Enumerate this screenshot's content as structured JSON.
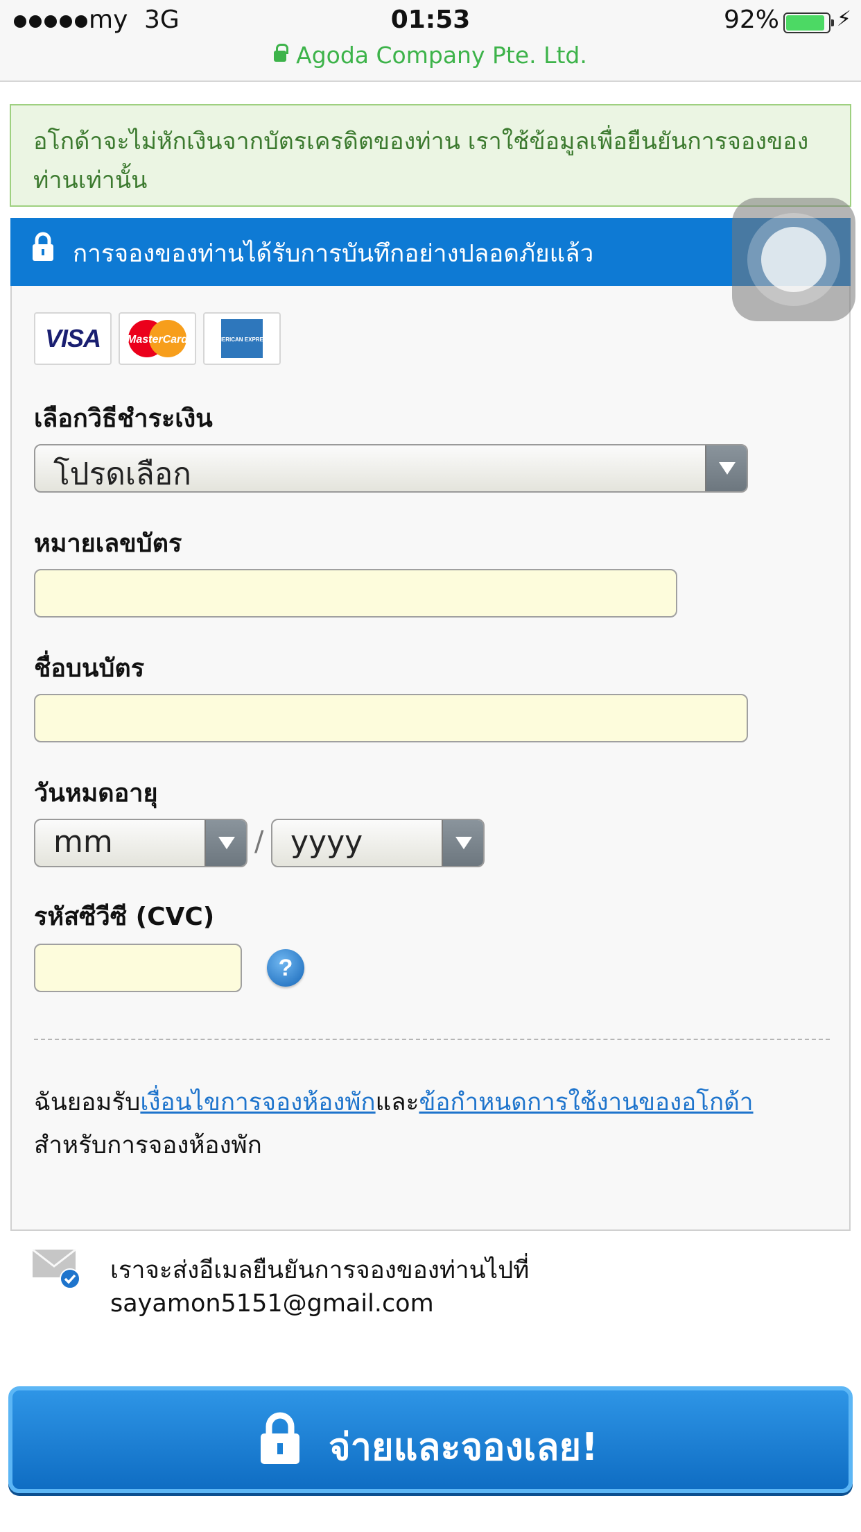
{
  "status_bar": {
    "carrier": "my",
    "network": "3G",
    "time": "01:53",
    "battery_percent": "92%",
    "battery_level": 0.92,
    "url": "Agoda Company Pte. Ltd."
  },
  "notice": {
    "text": "อโกด้าจะไม่หักเงินจากบัตรเครดิตของท่าน เราใช้ข้อมูลเพื่อยืนยันการจองของท่านเท่านั้น"
  },
  "secure_banner": {
    "text": "การจองของท่านได้รับการบันทึกอย่างปลอดภัยแล้ว"
  },
  "card_logos": [
    "visa-icon",
    "mastercard-icon",
    "amex-icon"
  ],
  "card_logo_text": {
    "visa": "VISA",
    "mastercard": "MasterCard",
    "amex": "AMERICAN EXPRESS"
  },
  "form": {
    "payment_method_label": "เลือกวิธีชำระเงิน",
    "payment_method_value": "โปรดเลือก",
    "card_number_label": "หมายเลขบัตร",
    "card_number_value": "",
    "card_name_label": "ชื่อบนบัตร",
    "card_name_value": "",
    "expiry_label": "วันหมดอายุ",
    "expiry_month_value": "mm",
    "expiry_separator": "/",
    "expiry_year_value": "yyyy",
    "cvc_label": "รหัสซีวีซี (CVC)",
    "cvc_value": "",
    "cvc_help": "?"
  },
  "terms": {
    "prefix": "ฉันยอมรับ",
    "link1": "เงื่อนไขการจองห้องพัก",
    "middle": "และ",
    "link2": "ข้อกำหนดการใช้งานของอโกด้า",
    "suffix": "สำหรับการจองห้องพัก"
  },
  "email_notice": {
    "line1": "เราจะส่งอีเมลยืนยันการจองของท่านไปที่",
    "email": "sayamon5151@gmail.com"
  },
  "pay_button": {
    "label": "จ่ายและจองเลย!"
  },
  "colors": {
    "primary_blue": "#0e7ad4",
    "notice_green": "#3c7a2f",
    "url_green": "#3db34a",
    "input_yellow": "#fdfcdc",
    "link_blue": "#1e74cc"
  }
}
